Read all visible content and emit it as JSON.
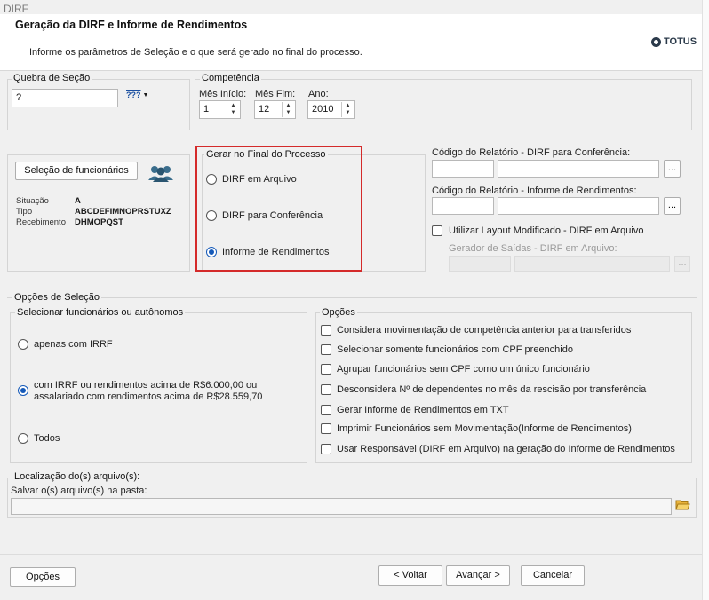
{
  "window": {
    "title": "DIRF"
  },
  "header": {
    "title": "Geração da DIRF e Informe de Rendimentos",
    "subtitle": "Informe os parâmetros de Seleção e o que será gerado no final do processo.",
    "logo_text": "TOTUS"
  },
  "quebra": {
    "legend": "Quebra de Seção",
    "value": "?",
    "picker_label": "???"
  },
  "competencia": {
    "legend": "Competência",
    "mes_inicio_label": "Mês Início:",
    "mes_inicio_value": "1",
    "mes_fim_label": "Mês Fim:",
    "mes_fim_value": "12",
    "ano_label": "Ano:",
    "ano_value": "2010"
  },
  "selecao": {
    "button_label": "Seleção de funcionários",
    "rows": [
      {
        "label": "Situação",
        "value": "A"
      },
      {
        "label": "Tipo",
        "value": "ABCDEFIMNOPRSTUXZ"
      },
      {
        "label": "Recebimento",
        "value": "DHMOPQST"
      }
    ]
  },
  "gerar": {
    "legend": "Gerar no Final do Processo",
    "options": [
      {
        "label": "DIRF em Arquivo",
        "selected": false
      },
      {
        "label": "DIRF para Conferência",
        "selected": false
      },
      {
        "label": "Informe de Rendimentos",
        "selected": true
      }
    ],
    "highlight_color": "#d42a2a"
  },
  "codigos": {
    "conf_label": "Código do Relatório - DIRF para Conferência:",
    "informe_label": "Código do Relatório - Informe de Rendimentos:",
    "browse_label": "...",
    "layout_check_label": "Utilizar Layout Modificado - DIRF em Arquivo",
    "gerador_label": "Gerador de Saídas - DIRF em Arquivo:"
  },
  "opcoes_selecao": {
    "legend": "Opções de Seleção",
    "func_legend": "Selecionar funcionários ou autônomos",
    "func_options": [
      {
        "label": "apenas com IRRF",
        "selected": false
      },
      {
        "line1": "com IRRF ou rendimentos acima de R$6.000,00 ou",
        "line2": "assalariado com rendimentos acima de R$28.559,70",
        "selected": true
      },
      {
        "label": "Todos",
        "selected": false
      }
    ],
    "opcoes_legend": "Opções",
    "opcoes": [
      "Considera movimentação de competência anterior para transferidos",
      "Selecionar somente funcionários com CPF preenchido",
      "Agrupar funcionários sem CPF como um único funcionário",
      "Desconsidera Nº de dependentes no mês da rescisão por transferência",
      "Gerar Informe de Rendimentos em TXT",
      "Imprimir Funcionários sem Movimentação(Informe de Rendimentos)",
      "Usar Responsável (DIRF em Arquivo) na geração do Informe de Rendimentos"
    ]
  },
  "localizacao": {
    "legend": "Localização do(s) arquivo(s):",
    "pasta_label": "Salvar o(s) arquivo(s) na pasta:",
    "pasta_value": ""
  },
  "footer": {
    "opcoes_label": "Opções",
    "voltar_label": "< Voltar",
    "avancar_label": "Avançar >",
    "cancelar_label": "Cancelar"
  }
}
